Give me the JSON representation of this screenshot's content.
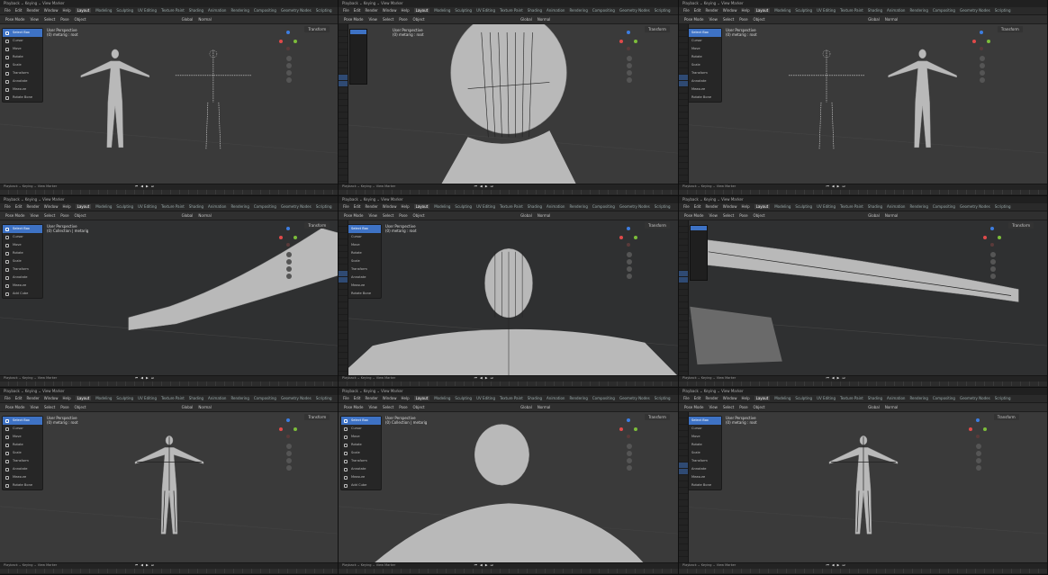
{
  "app": {
    "topbar": "Playback  ⌄  Keying  ⌄  View  Marker",
    "menu": [
      "File",
      "Edit",
      "Render",
      "Window",
      "Help"
    ],
    "workspaces": [
      "Layout",
      "Modeling",
      "Sculpting",
      "UV Editing",
      "Texture Paint",
      "Shading",
      "Animation",
      "Rendering",
      "Compositing",
      "Geometry Nodes",
      "Scripting"
    ],
    "active_workspace": "Layout",
    "header_items": [
      "Pose Mode",
      "View",
      "Select",
      "Pose",
      "Object"
    ],
    "header_right": [
      "Global",
      "Normal"
    ],
    "transform_label": "Transform",
    "timeline_items": "Playback  ⌄  Keying  ⌄  View  Marker",
    "playback_controls": "⏮ ◀ ▶ ⏭"
  },
  "tools": [
    "Select Box",
    "Cursor",
    "Move",
    "Rotate",
    "Scale",
    "Transform",
    "Annotate",
    "Measure",
    "Rotate Bone"
  ],
  "tools_alt": [
    "Select Box",
    "Cursor",
    "Move",
    "Rotate",
    "Scale",
    "Transform",
    "Annotate",
    "Measure",
    "Add Cube"
  ],
  "panels": [
    {
      "overlay": "User Perspective\n(0) metarig : root"
    },
    {
      "overlay": "User Perspective\n(0) metarig : root"
    },
    {
      "overlay": "User Perspective\n(0) metarig : root"
    },
    {
      "overlay": "User Perspective\n(0) Collection | metarig"
    },
    {
      "overlay": "User Perspective\n(0) metarig : root"
    },
    {
      "overlay": ""
    },
    {
      "overlay": "User Perspective\n(0) metarig : root"
    },
    {
      "overlay": "User Perspective\n(0) Collection | metarig"
    },
    {
      "overlay": "User Perspective\n(0) metarig : root"
    }
  ],
  "colors": {
    "accent": "#3e72c4",
    "viewport": "#3a3a3a",
    "x_axis": "#e04a4a",
    "y_axis": "#7cbd3a",
    "z_axis": "#3d7de0"
  }
}
